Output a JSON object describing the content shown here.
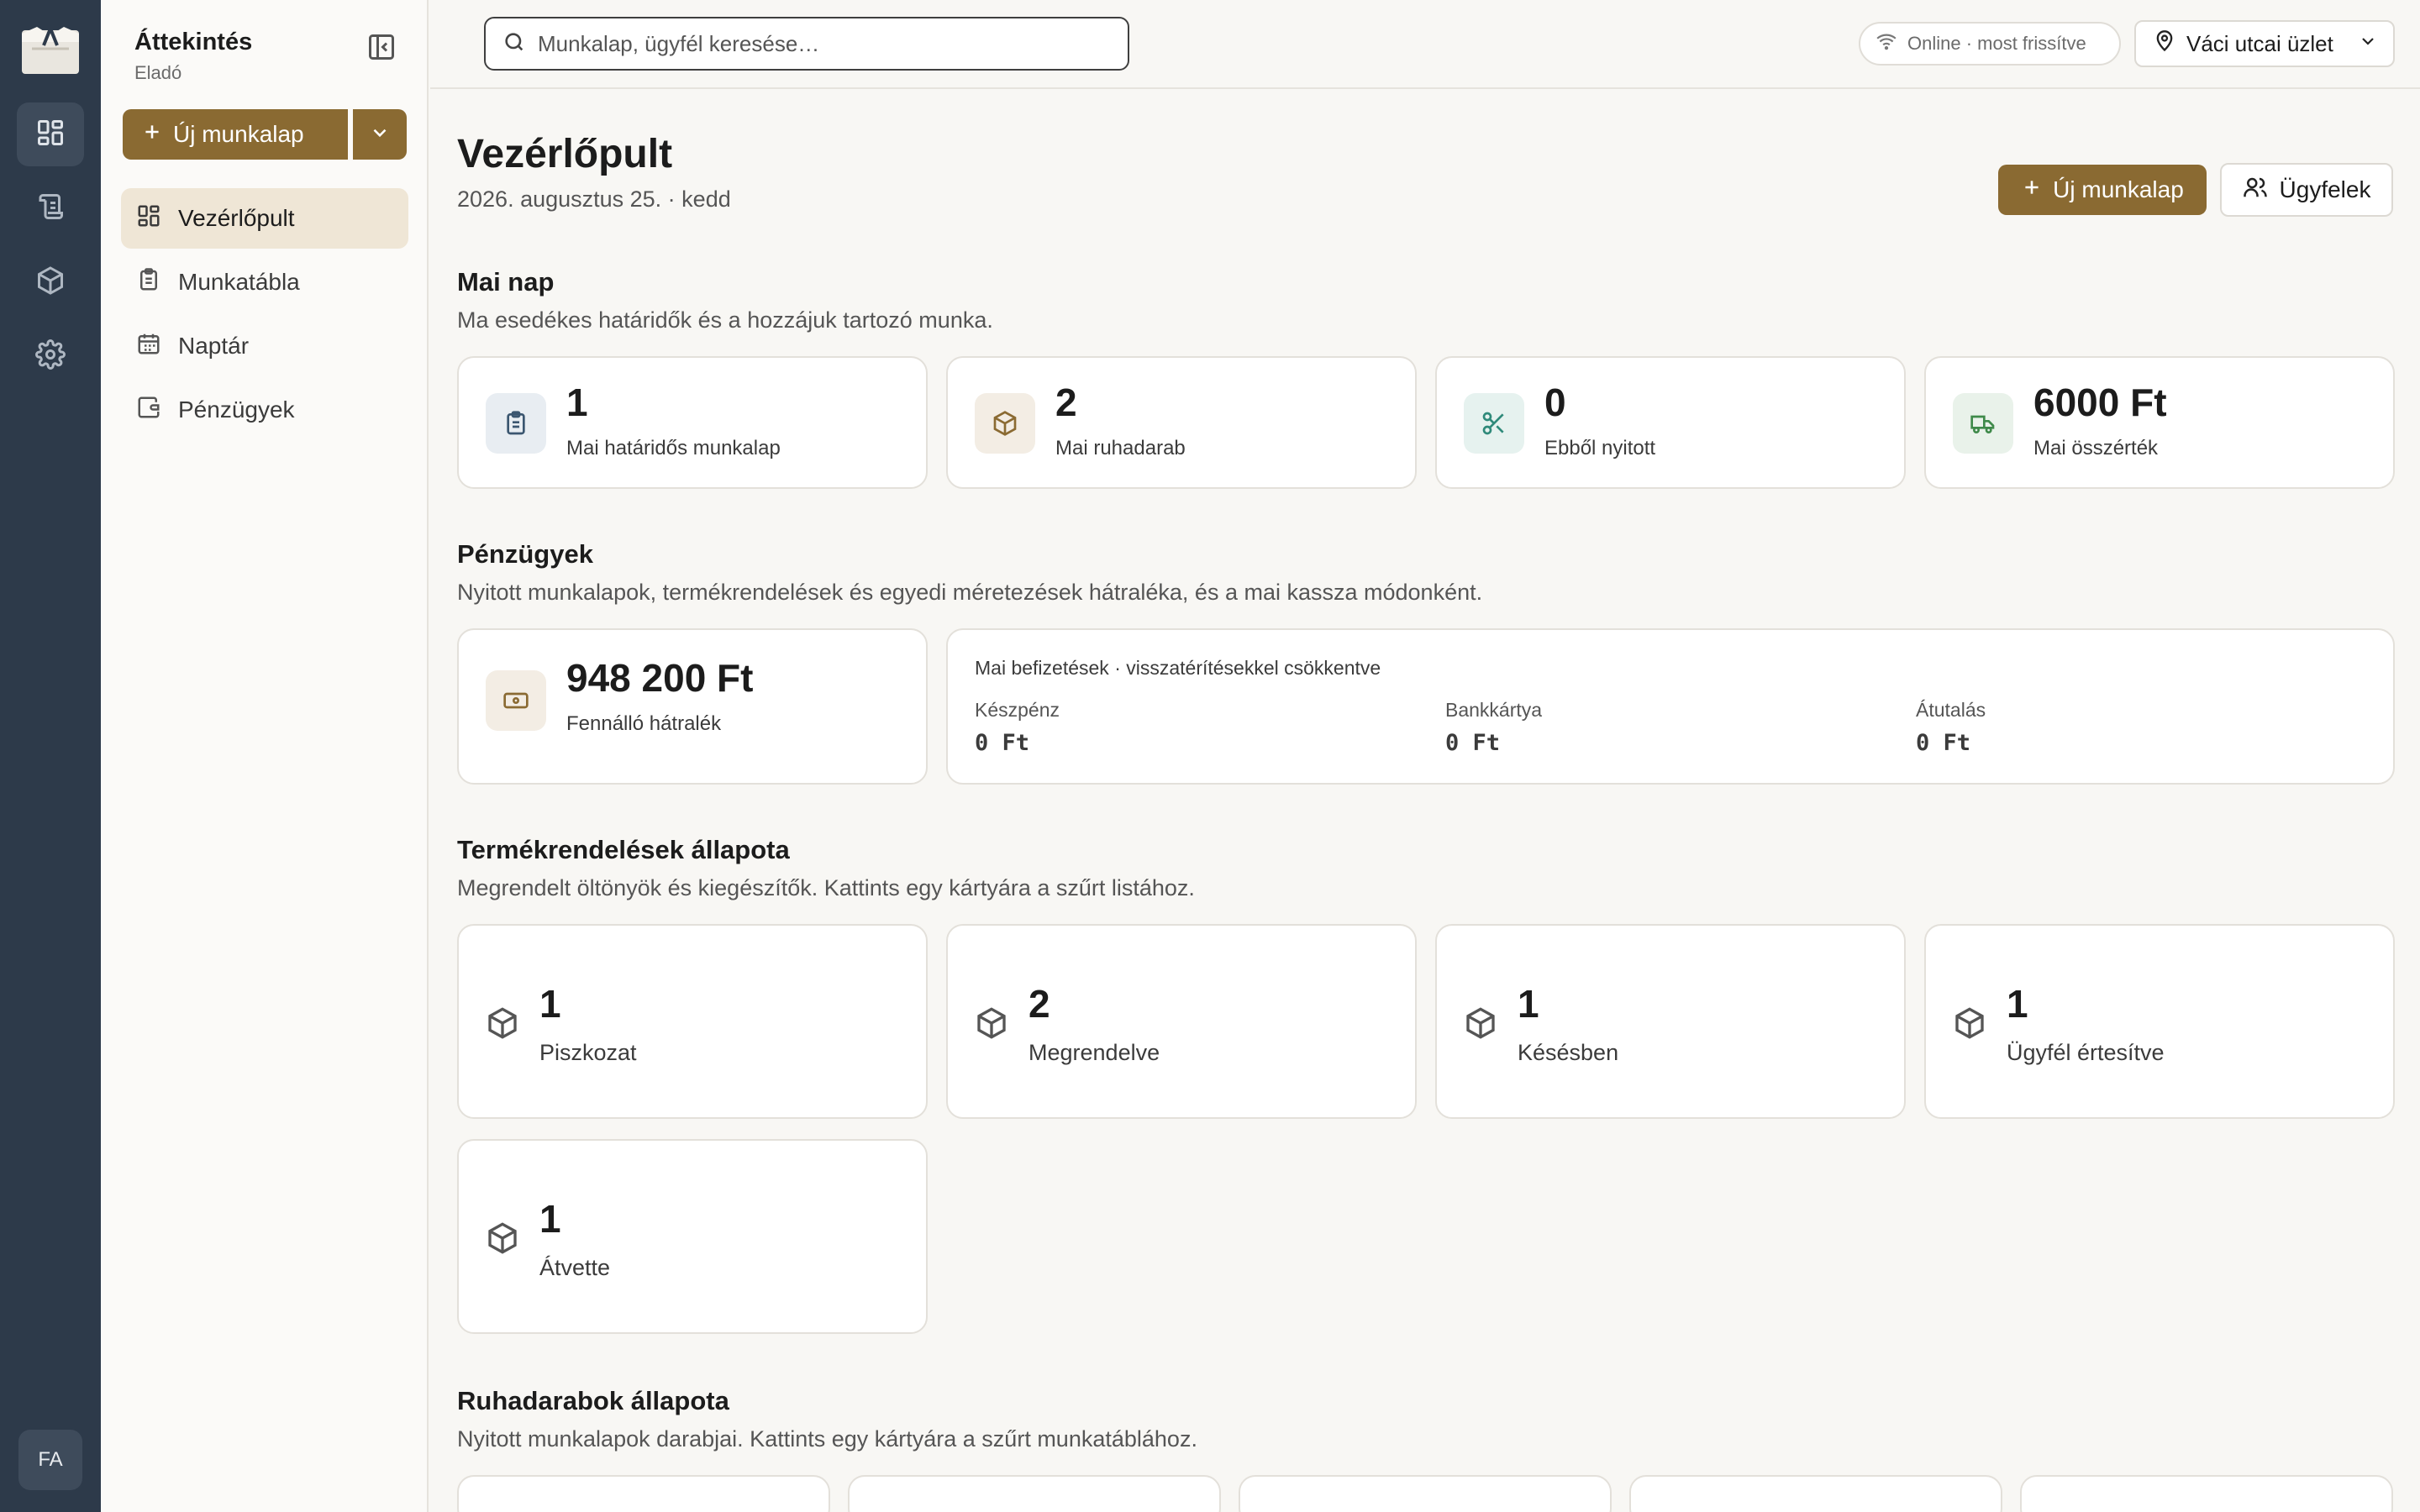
{
  "sidebar": {
    "title": "Áttekintés",
    "subtitle": "Eladó",
    "new_button": "Új munkalap",
    "items": [
      {
        "label": "Vezérlőpult",
        "icon": "dashboard-icon",
        "active": true
      },
      {
        "label": "Munkatábla",
        "icon": "clipboard-icon",
        "active": false
      },
      {
        "label": "Naptár",
        "icon": "calendar-icon",
        "active": false
      },
      {
        "label": "Pénzügyek",
        "icon": "wallet-icon",
        "active": false
      }
    ]
  },
  "rail": {
    "icons": [
      "app-logo-icon",
      "dashboard-icon",
      "scroll-icon",
      "box-icon",
      "gear-icon"
    ],
    "avatar": "FA"
  },
  "topbar": {
    "search_placeholder": "Munkalap, ügyfél keresése…",
    "status": "Online · most frissítve",
    "store": "Váci utcai üzlet"
  },
  "header": {
    "title": "Vezérlőpult",
    "date": "2026. augusztus 25. · kedd",
    "new_button": "Új munkalap",
    "customers_button": "Ügyfelek"
  },
  "today": {
    "title": "Mai nap",
    "description": "Ma esedékes határidők és a hozzájuk tartozó munka.",
    "stats": [
      {
        "value": "1",
        "label": "Mai határidős munkalap",
        "icon": "clipboard-icon",
        "color": "#3b5670",
        "bg": "#e8edf2"
      },
      {
        "value": "2",
        "label": "Mai ruhadarab",
        "icon": "box-icon",
        "color": "#8a6a32",
        "bg": "#f3ede4"
      },
      {
        "value": "0",
        "label": "Ebből nyitott",
        "icon": "scissors-icon",
        "color": "#2f8a7a",
        "bg": "#e6f2ef"
      },
      {
        "value": "6000 Ft",
        "label": "Mai összérték",
        "icon": "truck-icon",
        "color": "#3f8a4a",
        "bg": "#e9f2ea"
      }
    ]
  },
  "finance": {
    "title": "Pénzügyek",
    "description": "Nyitott munkalapok, termékrendelések és egyedi méretezések hátraléka, és a mai kassza módonként.",
    "outstanding": {
      "value": "948 200 Ft",
      "label": "Fennálló hátralék",
      "icon": "banknote-icon"
    },
    "payments_title": "Mai befizetések · visszatérítésekkel csökkentve",
    "payments": [
      {
        "label": "Készpénz",
        "value": "0 Ft"
      },
      {
        "label": "Bankkártya",
        "value": "0 Ft"
      },
      {
        "label": "Átutalás",
        "value": "0 Ft"
      }
    ]
  },
  "orders": {
    "title": "Termékrendelések állapota",
    "description": "Megrendelt öltönyök és kiegészítők. Kattints egy kártyára a szűrt listához.",
    "cards": [
      {
        "value": "1",
        "label": "Piszkozat"
      },
      {
        "value": "2",
        "label": "Megrendelve"
      },
      {
        "value": "1",
        "label": "Késésben"
      },
      {
        "value": "1",
        "label": "Ügyfél értesítve"
      },
      {
        "value": "1",
        "label": "Átvette"
      }
    ]
  },
  "garments": {
    "title": "Ruhadarabok állapota",
    "description": "Nyitott munkalapok darabjai. Kattints egy kártyára a szűrt munkatáblához."
  }
}
